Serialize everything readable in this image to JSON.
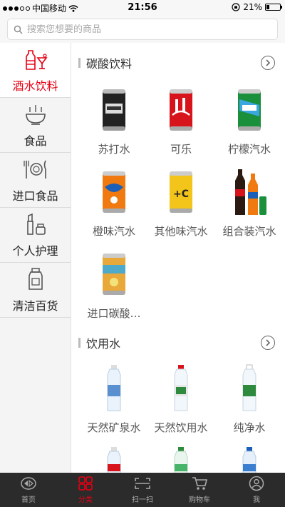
{
  "status_bar": {
    "carrier": "中国移动",
    "time": "21:56",
    "battery": "21%",
    "battery_level": 0.21
  },
  "search": {
    "placeholder": "搜索您想要的商品"
  },
  "sidebar": {
    "items": [
      {
        "label": "酒水饮料",
        "icon": "drinks-icon",
        "active": true
      },
      {
        "label": "食品",
        "icon": "bowl-icon",
        "active": false
      },
      {
        "label": "进口食品",
        "icon": "cutlery-icon",
        "active": false
      },
      {
        "label": "个人护理",
        "icon": "lipstick-icon",
        "active": false
      },
      {
        "label": "清洁百货",
        "icon": "detergent-icon",
        "active": false
      }
    ]
  },
  "sections": [
    {
      "title": "碳酸饮料",
      "products": [
        {
          "name": "苏打水"
        },
        {
          "name": "可乐"
        },
        {
          "name": "柠檬汽水"
        },
        {
          "name": "橙味汽水"
        },
        {
          "name": "其他味汽水"
        },
        {
          "name": "组合装汽水"
        },
        {
          "name": "进口碳酸…"
        }
      ]
    },
    {
      "title": "饮用水",
      "products": [
        {
          "name": "天然矿泉水"
        },
        {
          "name": "天然饮用水"
        },
        {
          "name": "纯净水"
        }
      ]
    }
  ],
  "tabbar": {
    "items": [
      {
        "label": "首页",
        "icon": "home-icon",
        "active": false
      },
      {
        "label": "分类",
        "icon": "category-icon",
        "active": true
      },
      {
        "label": "扫一扫",
        "icon": "scan-icon",
        "active": false
      },
      {
        "label": "购物车",
        "icon": "cart-icon",
        "active": false
      },
      {
        "label": "我",
        "icon": "profile-icon",
        "active": false
      }
    ]
  },
  "colors": {
    "accent": "#e60012",
    "tabbar_bg": "#2b2b2b",
    "sidebar_bg": "#f4f4f4"
  }
}
